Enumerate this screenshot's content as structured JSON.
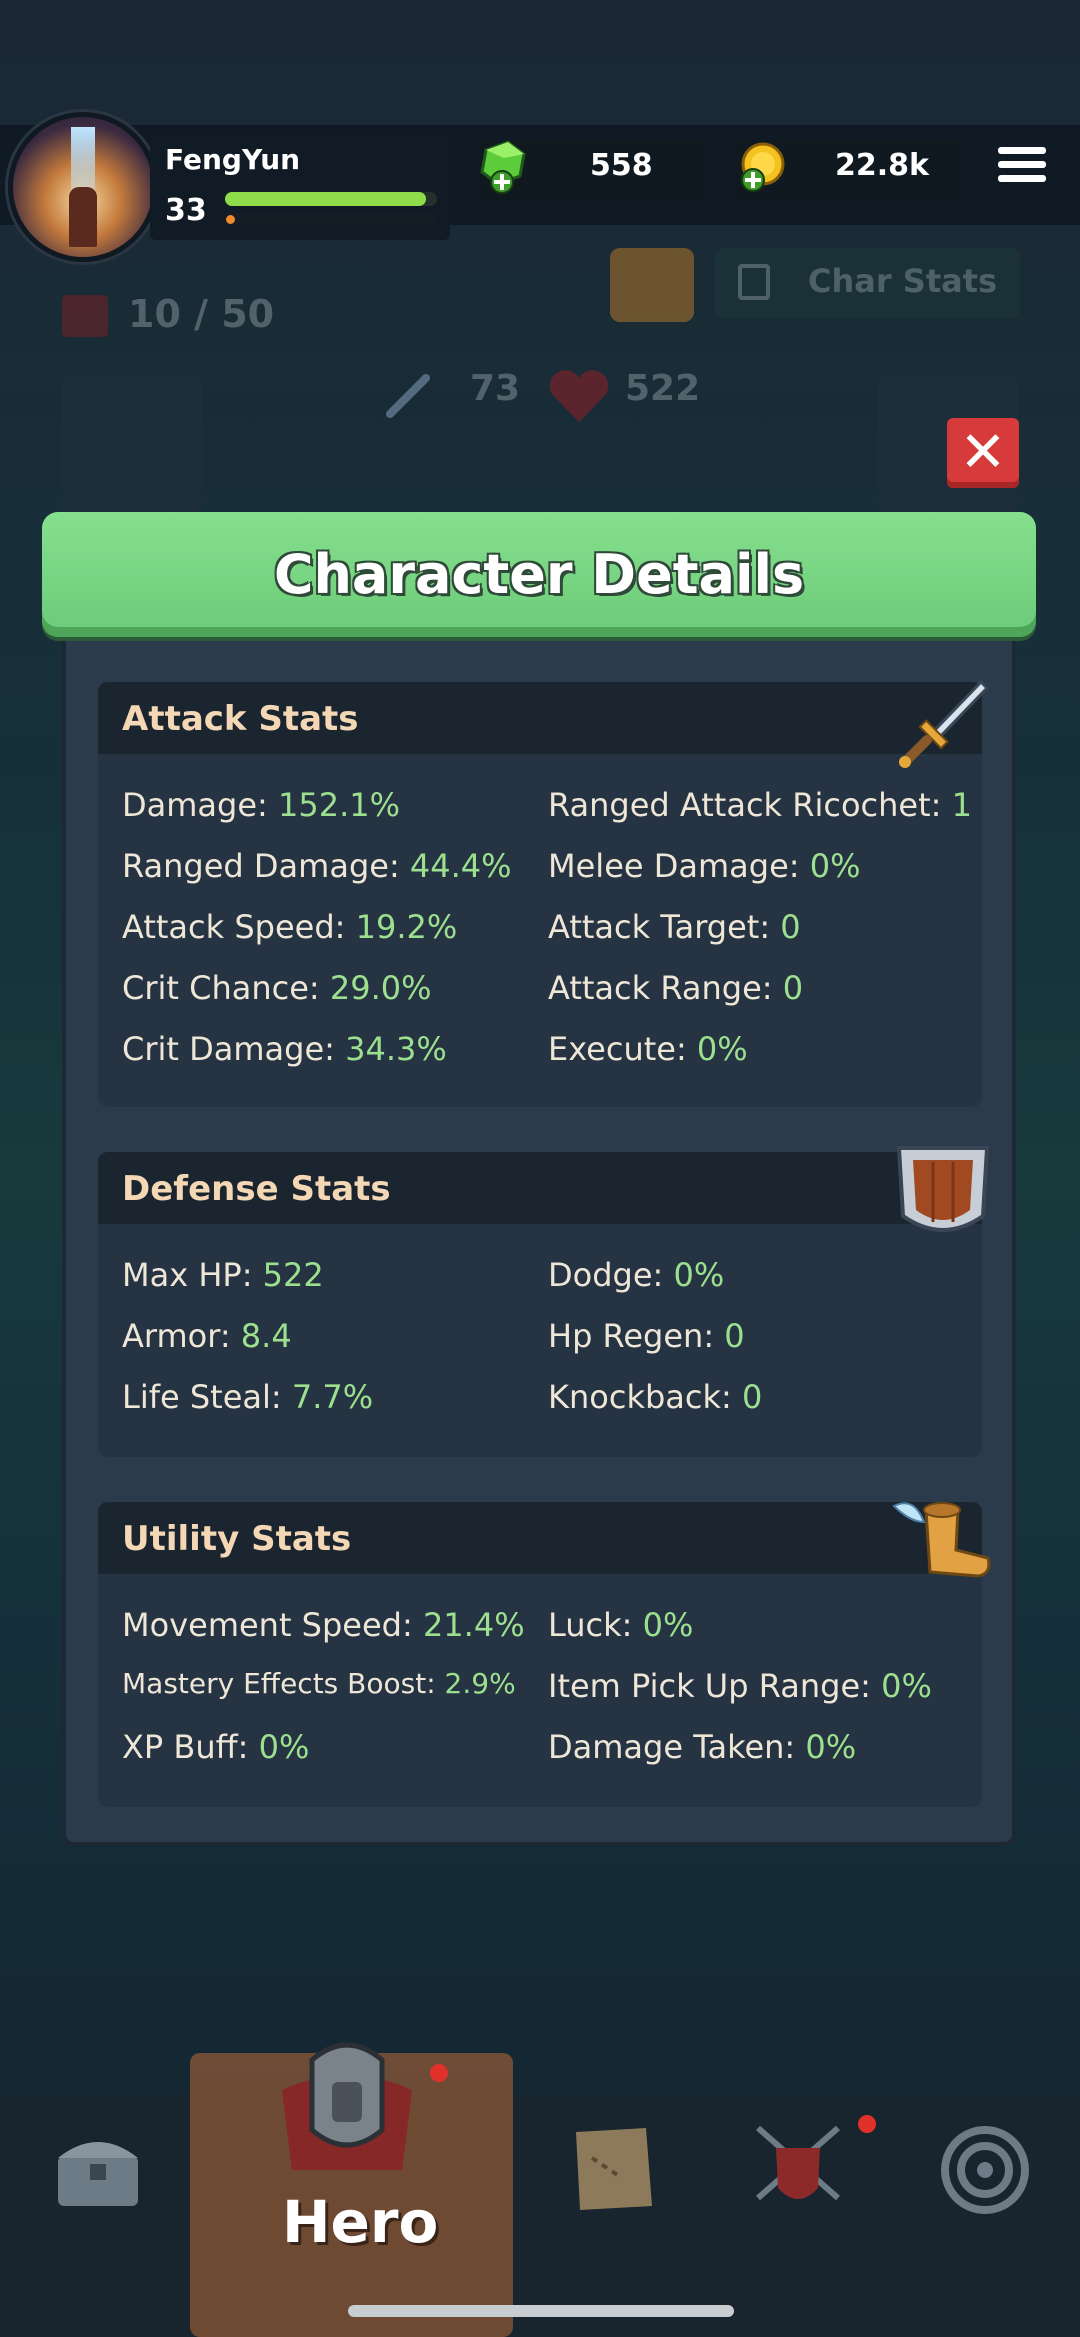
{
  "player": {
    "name": "FengYun",
    "level": "33",
    "hp_fraction": 0.95,
    "xp_fraction": 0.04
  },
  "currency": {
    "gems": "558",
    "gold": "22.8k"
  },
  "background": {
    "char_stats_label": "Char Stats",
    "capacity": "10 / 50",
    "attack": "73",
    "hp": "522"
  },
  "modal": {
    "title": "Character Details",
    "attack": {
      "title": "Attack Stats",
      "left": [
        {
          "label": "Damage: ",
          "value": "152.1%"
        },
        {
          "label": "Ranged Damage: ",
          "value": "44.4%"
        },
        {
          "label": "Attack Speed: ",
          "value": "19.2%"
        },
        {
          "label": "Crit Chance: ",
          "value": "29.0%"
        },
        {
          "label": "Crit Damage: ",
          "value": "34.3%"
        }
      ],
      "right": [
        {
          "label": "Ranged Attack Ricochet: ",
          "value": "1"
        },
        {
          "label": "Melee Damage: ",
          "value": "0%"
        },
        {
          "label": "Attack Target: ",
          "value": "0"
        },
        {
          "label": "Attack Range: ",
          "value": "0"
        },
        {
          "label": "Execute: ",
          "value": "0%"
        }
      ]
    },
    "defense": {
      "title": "Defense Stats",
      "left": [
        {
          "label": "Max HP: ",
          "value": "522"
        },
        {
          "label": "Armor: ",
          "value": "8.4"
        },
        {
          "label": "Life Steal: ",
          "value": "7.7%"
        }
      ],
      "right": [
        {
          "label": "Dodge: ",
          "value": "0%"
        },
        {
          "label": "Hp Regen: ",
          "value": "0"
        },
        {
          "label": "Knockback: ",
          "value": "0"
        }
      ]
    },
    "utility": {
      "title": "Utility Stats",
      "left": [
        {
          "label": "Movement Speed: ",
          "value": "21.4%"
        },
        {
          "label": "Mastery Effects Boost: ",
          "value": "2.9%"
        },
        {
          "label": "XP Buff: ",
          "value": "0%"
        }
      ],
      "right": [
        {
          "label": "Luck: ",
          "value": "0%"
        },
        {
          "label": "Item Pick Up Range: ",
          "value": "0%"
        },
        {
          "label": "Damage Taken: ",
          "value": "0%"
        }
      ]
    }
  },
  "nav": {
    "active_label": "Hero"
  },
  "colors": {
    "header_green": "#7ad486",
    "value_green": "#9ce08f",
    "section_title": "#f4d7b4",
    "close_red": "#d63a3a"
  }
}
